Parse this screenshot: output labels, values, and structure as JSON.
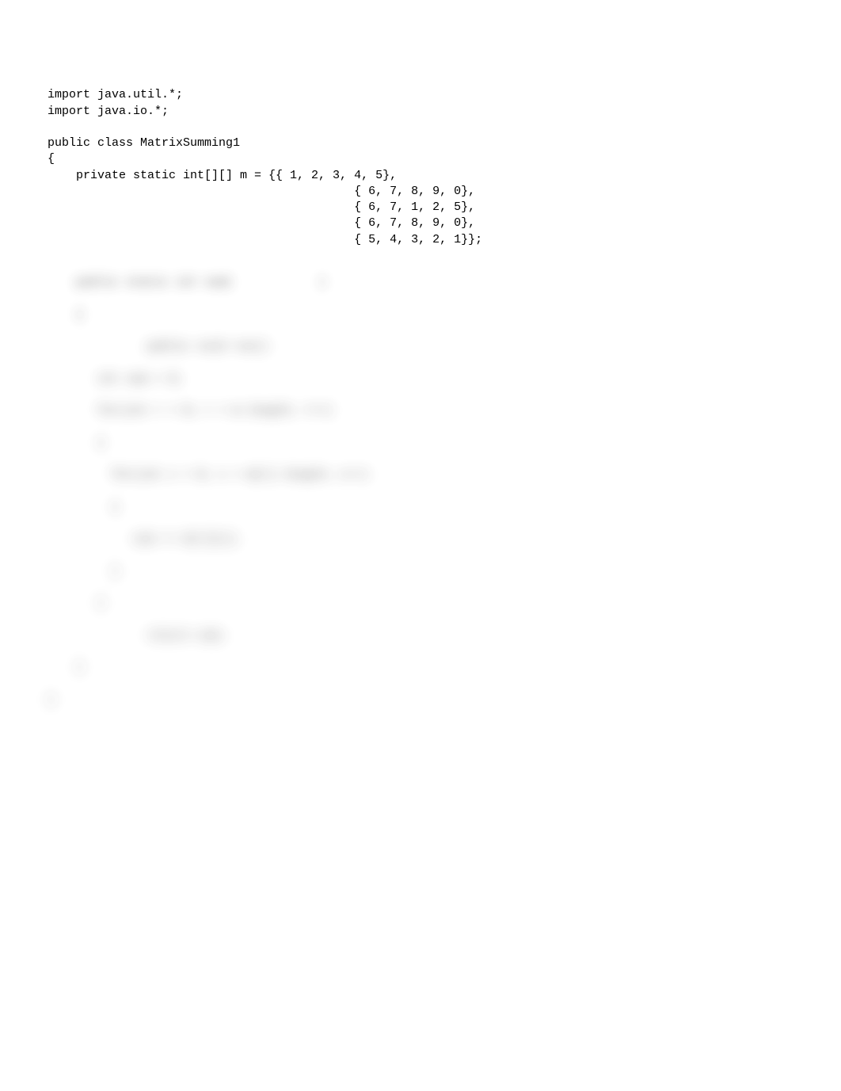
{
  "code": {
    "line1": "import java.util.*;",
    "line2": "import java.io.*;",
    "line3": "",
    "line4": "public class MatrixSumming1",
    "line5": "{",
    "line6": "    private static int[][] m = {{ 1, 2, 3, 4, 5},",
    "line7": "                                           { 6, 7, 8, 9, 0},",
    "line8": "                                           { 6, 7, 1, 2, 5},",
    "line9": "                                           { 6, 7, 8, 9, 0},",
    "line10": "                                           { 5, 4, 3, 2, 1}};"
  },
  "blurred": {
    "l1": "    public static int sum(            )",
    "l2": "    {",
    "l3": "              public void run()",
    "l4": "       int sum = 0;",
    "l5": "       for(int r = 0; r < m.length; r++)",
    "l6": "       {",
    "l7": "         for(int c = 0; c < m[r].length; c++)",
    "l8": "         {",
    "l9": "            sum += m[r][c];",
    "l10": "         }",
    "l11": "       }",
    "l12": "              return sum;",
    "l13": "    }",
    "l14": "}"
  }
}
